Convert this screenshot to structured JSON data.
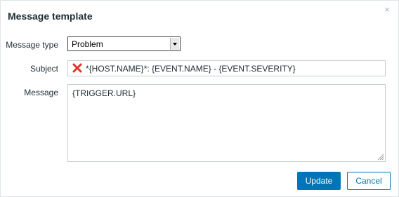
{
  "dialog": {
    "title": "Message template",
    "close_glyph": "×"
  },
  "form": {
    "message_type": {
      "label": "Message type",
      "selected": "Problem"
    },
    "subject": {
      "label": "Subject",
      "value": "*{HOST.NAME}*: {EVENT.NAME} - {EVENT.SEVERITY}",
      "status_icon": "error-x-icon",
      "status_color": "#e5332a"
    },
    "message": {
      "label": "Message",
      "value": "{TRIGGER.URL}"
    }
  },
  "buttons": {
    "update_label": "Update",
    "cancel_label": "Cancel"
  },
  "colors": {
    "primary": "#0275b8",
    "text": "#1f2c33",
    "border": "#c6ccd0"
  }
}
